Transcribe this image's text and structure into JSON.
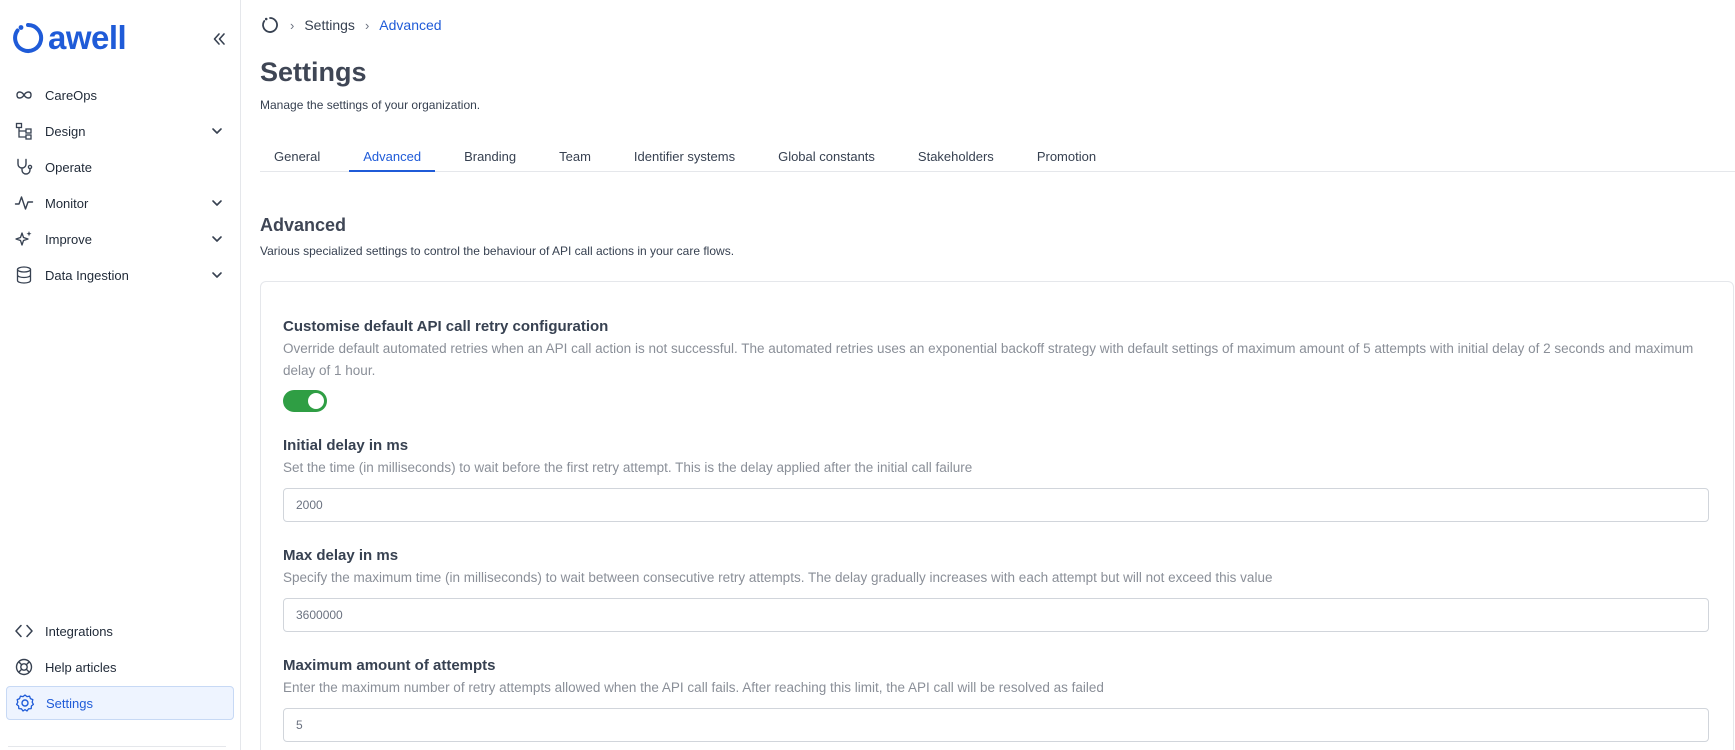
{
  "brand": {
    "name": "awell",
    "color": "#1f5bd8"
  },
  "sidebar": {
    "collapse_icon": "double-chevron-left-icon",
    "top_items": [
      {
        "label": "CareOps",
        "icon": "infinity-icon",
        "expandable": false
      },
      {
        "label": "Design",
        "icon": "tree-structure-icon",
        "expandable": true
      },
      {
        "label": "Operate",
        "icon": "stethoscope-icon",
        "expandable": false
      },
      {
        "label": "Monitor",
        "icon": "activity-icon",
        "expandable": true
      },
      {
        "label": "Improve",
        "icon": "sparkles-icon",
        "expandable": true
      },
      {
        "label": "Data Ingestion",
        "icon": "database-icon",
        "expandable": true
      }
    ],
    "bottom_items": [
      {
        "label": "Integrations",
        "icon": "code-icon"
      },
      {
        "label": "Help articles",
        "icon": "lifebuoy-icon"
      },
      {
        "label": "Settings",
        "icon": "gear-icon",
        "active": true
      }
    ]
  },
  "breadcrumb": {
    "home_icon": "awell-home-icon",
    "items": [
      "Settings",
      "Advanced"
    ]
  },
  "page": {
    "title": "Settings",
    "subtitle": "Manage the settings of your organization."
  },
  "tabs": [
    {
      "label": "General"
    },
    {
      "label": "Advanced",
      "active": true
    },
    {
      "label": "Branding"
    },
    {
      "label": "Team"
    },
    {
      "label": "Identifier systems"
    },
    {
      "label": "Global constants"
    },
    {
      "label": "Stakeholders"
    },
    {
      "label": "Promotion"
    }
  ],
  "section": {
    "title": "Advanced",
    "subtitle": "Various specialized settings to control the behaviour of API call actions in your care flows."
  },
  "retry": {
    "title": "Customise default API call retry configuration",
    "description": "Override default automated retries when an API call action is not successful. The automated retries uses an exponential backoff strategy with default settings of maximum amount of 5 attempts with initial delay of 2 seconds and maximum delay of 1 hour.",
    "enabled": true,
    "toggle_color": "#2f9e44"
  },
  "fields": {
    "initial_delay": {
      "title": "Initial delay in ms",
      "description": "Set the time (in milliseconds) to wait before the first retry attempt. This is the delay applied after the initial call failure",
      "value": "2000"
    },
    "max_delay": {
      "title": "Max delay in ms",
      "description": "Specify the maximum time (in milliseconds) to wait between consecutive retry attempts. The delay gradually increases with each attempt but will not exceed this value",
      "value": "3600000"
    },
    "max_attempts": {
      "title": "Maximum amount of attempts",
      "description": "Enter the maximum number of retry attempts allowed when the API call fails. After reaching this limit, the API call will be resolved as failed",
      "value": "5"
    }
  }
}
